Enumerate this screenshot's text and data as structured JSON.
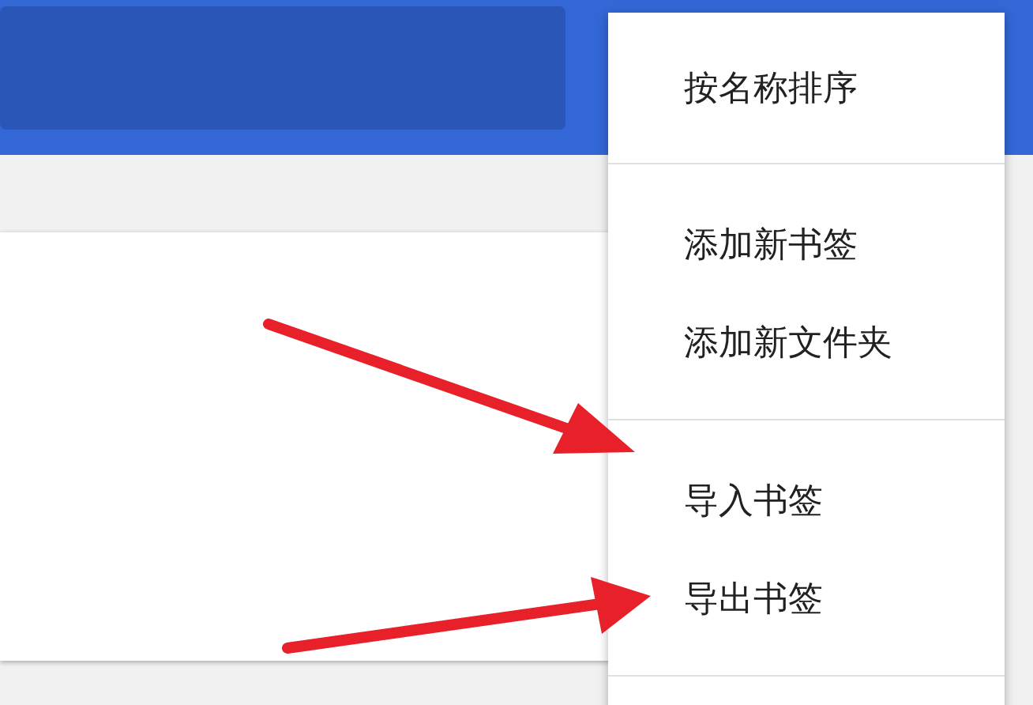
{
  "menu": {
    "groups": [
      {
        "items": [
          {
            "label": "按名称排序"
          }
        ]
      },
      {
        "items": [
          {
            "label": "添加新书签"
          },
          {
            "label": "添加新文件夹"
          }
        ]
      },
      {
        "items": [
          {
            "label": "导入书签"
          },
          {
            "label": "导出书签"
          }
        ]
      }
    ]
  }
}
